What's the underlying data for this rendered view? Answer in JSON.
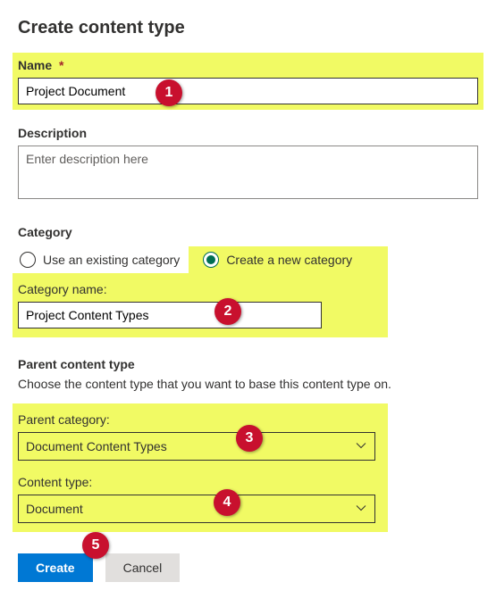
{
  "page": {
    "title": "Create content type"
  },
  "name": {
    "label": "Name",
    "required_mark": "*",
    "value": "Project Document"
  },
  "description": {
    "label": "Description",
    "placeholder": "Enter description here"
  },
  "category": {
    "label": "Category",
    "existing_label": "Use an existing category",
    "new_label": "Create a new category",
    "name_label": "Category name:",
    "name_value": "Project Content Types"
  },
  "parent": {
    "heading": "Parent content type",
    "help": "Choose the content type that you want to base this content type on.",
    "category_label": "Parent category:",
    "category_value": "Document Content Types",
    "type_label": "Content type:",
    "type_value": "Document"
  },
  "buttons": {
    "create": "Create",
    "cancel": "Cancel"
  },
  "callouts": {
    "c1": "1",
    "c2": "2",
    "c3": "3",
    "c4": "4",
    "c5": "5"
  }
}
